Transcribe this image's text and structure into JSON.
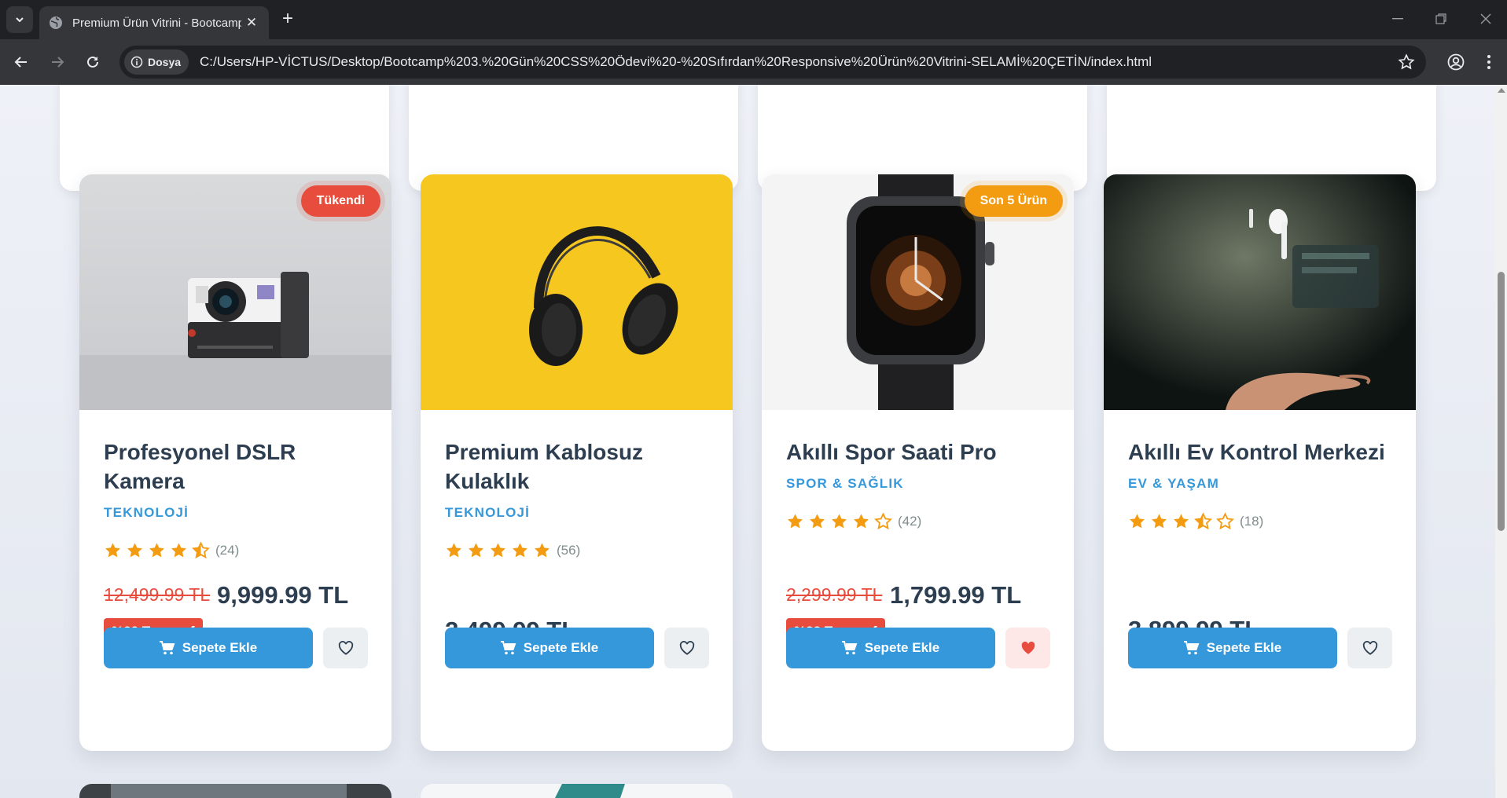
{
  "browser": {
    "tab_title": "Premium Ürün Vitrini - Bootcamp",
    "site_chip": "Dosya",
    "url": "C:/Users/HP-VİCTUS/Desktop/Bootcamp%203.%20Gün%20CSS%20Ödevi%20-%20Sıfırdan%20Responsive%20Ürün%20Vitrini-SELAMİ%20ÇETİN/index.html"
  },
  "colors": {
    "accent_blue": "#3498db",
    "title_dark": "#2c3e50",
    "sale_red": "#e74c3c",
    "badge_orange": "#f39c12",
    "star_orange": "#f39c12"
  },
  "products": [
    {
      "badge": "Tükendi",
      "badge_color": "red",
      "image": "instant-camera-photo",
      "title": "Profesyonel DSLR Kamera",
      "category": "TEKNOLOJİ",
      "rating": 4.5,
      "reviews": "(24)",
      "old_price": "12,499.99 TL",
      "price": "9,999.99 TL",
      "saving": "%20 Tasarruf",
      "cart_label": "Sepete Ekle",
      "favorite": false
    },
    {
      "badge": "",
      "image": "headphones-photo",
      "title": "Premium Kablosuz Kulaklık",
      "category": "TEKNOLOJİ",
      "rating": 5,
      "reviews": "(56)",
      "old_price": "",
      "price": "2,499.99 TL",
      "saving": "",
      "cart_label": "Sepete Ekle",
      "favorite": false
    },
    {
      "badge": "Son 5 Ürün",
      "badge_color": "orange",
      "image": "smartwatch-photo",
      "title": "Akıllı Spor Saati Pro",
      "category": "SPOR & SAĞLIK",
      "rating": 4,
      "reviews": "(42)",
      "old_price": "2,299.99 TL",
      "price": "1,799.99 TL",
      "saving": "%22 Tasarruf",
      "cart_label": "Sepete Ekle",
      "favorite": true
    },
    {
      "badge": "",
      "image": "floating-earbud-photo",
      "title": "Akıllı Ev Kontrol Merkezi",
      "category": "EV & YAŞAM",
      "rating": 3.5,
      "reviews": "(18)",
      "old_price": "",
      "price": "3,899.99 TL",
      "saving": "",
      "cart_label": "Sepete Ekle",
      "favorite": false
    }
  ]
}
